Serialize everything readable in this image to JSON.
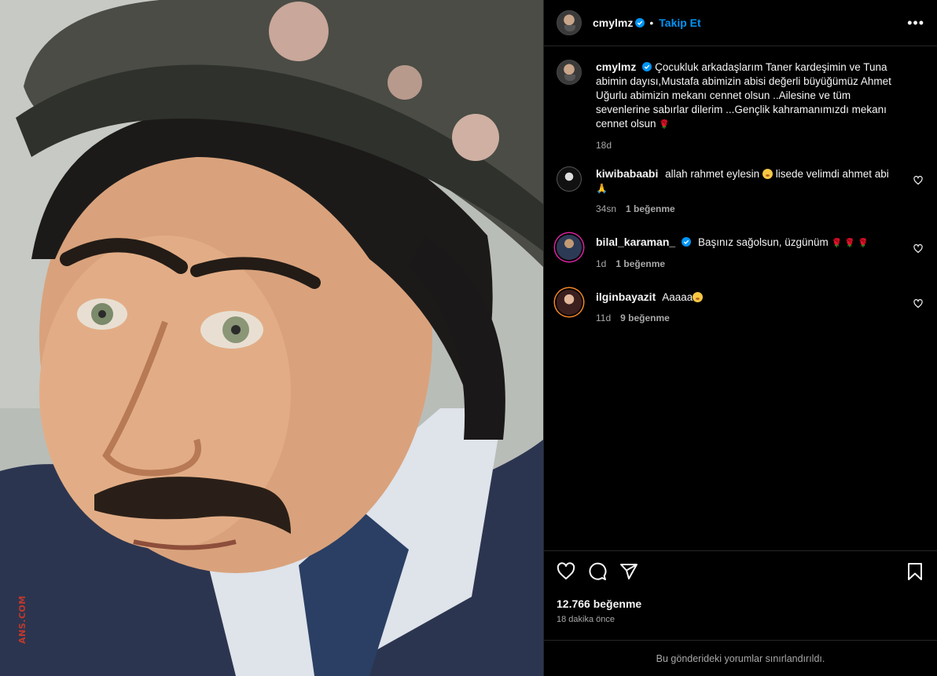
{
  "post": {
    "author": "cmylmz",
    "follow_label": "Takip Et",
    "more_label": "•••",
    "caption": "Çocukluk arkadaşlarım Taner kardeşimin ve Tuna abimin dayısı,Mustafa abimizin abisi değerli büyüğümüz Ahmet Uğurlu abimizin mekanı cennet olsun ..Ailesine ve tüm sevenlerine sabırlar dilerim ...Gençlik kahramanımızdı mekanı cennet olsun",
    "caption_time": "18d",
    "likes": "12.766 beğenme",
    "posted": "18 dakika önce",
    "restricted_note": "Bu gönderideki yorumlar sınırlandırıldı.",
    "media_watermark": "ANS.COM"
  },
  "comments": [
    {
      "user": "kiwibabaabi",
      "text_a": "allah rahmet eylesin",
      "text_b": "lisede velimdi ahmet abi",
      "time": "34sn",
      "likes": "1 beğenme"
    },
    {
      "user": "bilal_karaman_",
      "text": "Başınız sağolsun, üzgünüm",
      "time": "1d",
      "likes": "1 beğenme"
    },
    {
      "user": "ilginbayazit",
      "text": "Aaaaa",
      "time": "11d",
      "likes": "9 beğenme"
    }
  ],
  "icons": {
    "verified": "verified-badge-icon",
    "like": "heart-icon",
    "comment": "comment-icon",
    "share": "share-icon",
    "save": "bookmark-icon",
    "more": "more-icon"
  },
  "colors": {
    "accent": "#0095f6",
    "background": "#000000",
    "muted": "#a8a8a8"
  }
}
